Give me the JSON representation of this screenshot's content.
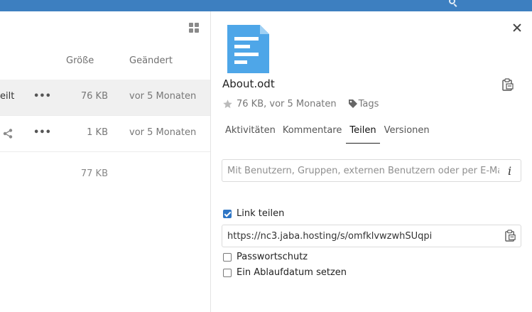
{
  "file_list": {
    "columns": {
      "size": "Größe",
      "modified": "Geändert"
    },
    "rows": [
      {
        "name": "eilt",
        "size": "76 KB",
        "modified": "vor 5 Monaten",
        "more": "•••"
      },
      {
        "name": "",
        "size": "1 KB",
        "modified": "vor 5 Monaten",
        "more": "•••"
      }
    ],
    "summary_size": "77 KB"
  },
  "sidebar": {
    "file_name": "About.odt",
    "meta": "76 KB, vor 5 Monaten",
    "tags_label": "Tags",
    "tabs": [
      {
        "label": "Aktivitäten",
        "active": false
      },
      {
        "label": "Kommentare",
        "active": false
      },
      {
        "label": "Teilen",
        "active": true
      },
      {
        "label": "Versionen",
        "active": false
      }
    ],
    "share_placeholder": "Mit Benutzern, Gruppen, externen Benutzern oder per E-Mail...",
    "info_glyph": "i",
    "link_share": {
      "label": "Link teilen",
      "checked": true
    },
    "share_url": "https://nc3.jaba.hosting/s/omfklvwzwhSUqpi",
    "password_protect": {
      "label": "Passwortschutz",
      "checked": false
    },
    "expiration": {
      "label": "Ein Ablaufdatum setzen",
      "checked": false
    }
  },
  "colors": {
    "header": "#3d7fc0",
    "file_icon": "#4ea6e8",
    "checkbox_accent": "#2f76c5",
    "star": "#bbbbbb"
  },
  "icons": {
    "file": "document-icon",
    "close": "close-icon",
    "copy": "clipboard-icon",
    "star": "star-icon",
    "tag": "tag-icon",
    "share": "share-icon",
    "grid": "grid-view-icon",
    "search": "search-icon"
  }
}
